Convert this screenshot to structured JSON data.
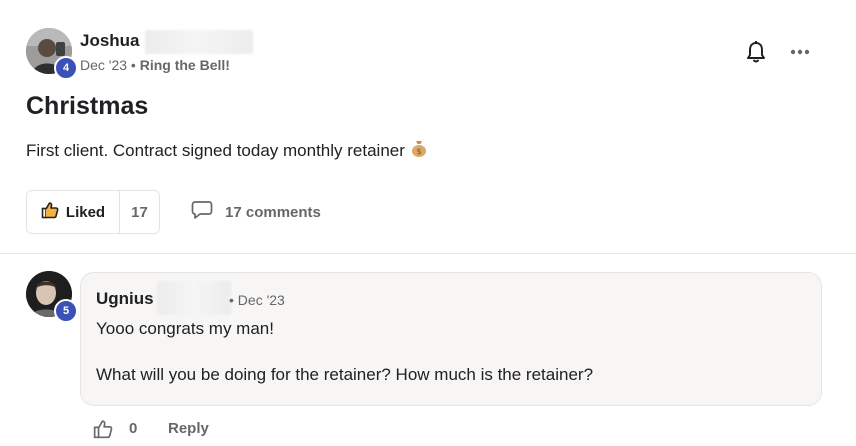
{
  "post": {
    "author": {
      "name": "Joshua",
      "level": "4",
      "avatar_icon": "user-avatar"
    },
    "meta": {
      "date": "Dec '23",
      "separator": "•",
      "category": "Ring the Bell!"
    },
    "title": "Christmas",
    "body": "First client. Contract signed today monthly retainer",
    "body_emoji": "money-bag-icon",
    "actions": {
      "liked_label": "Liked",
      "like_count": "17",
      "comments_label": "17 comments"
    },
    "header_icons": [
      "bell-icon",
      "more-options-icon"
    ]
  },
  "comment": {
    "author": {
      "name": "Ugnius",
      "level": "5"
    },
    "date_separator": "•",
    "date": "Dec '23",
    "lines": [
      "Yooo congrats my man!",
      "What will you be doing for the retainer? How much is the retainer?"
    ],
    "like_count": "0",
    "reply_label": "Reply"
  },
  "colors": {
    "level_badge": "#3c51b7",
    "muted_text": "#65676b",
    "bubble_bg": "#f7f6f5"
  }
}
